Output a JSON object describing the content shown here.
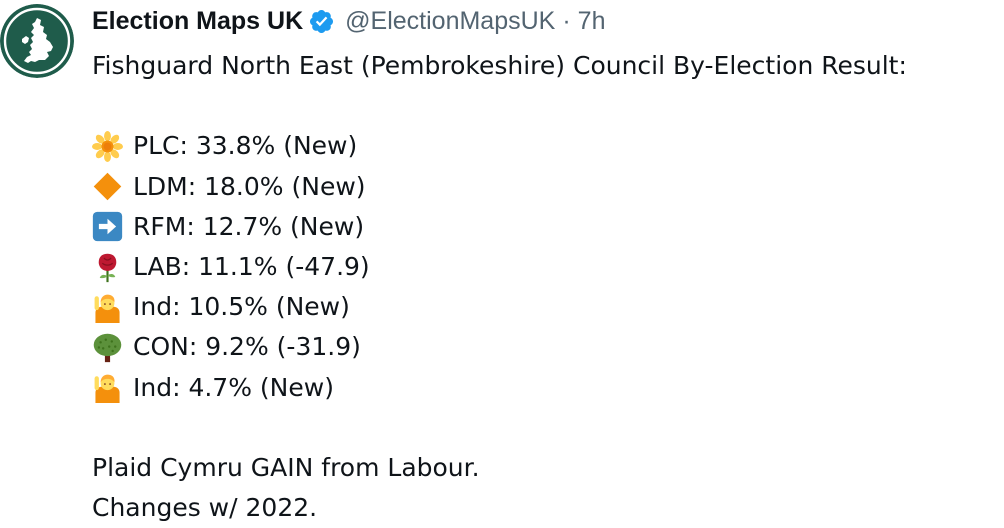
{
  "tweet": {
    "author": {
      "display_name": "Election Maps UK",
      "handle": "@ElectionMapsUK",
      "verified_icon": "verified-badge-icon",
      "avatar_icon": "uk-map-logo-icon"
    },
    "separator": "·",
    "time_ago": "7h",
    "headline": "Fishguard North East (Pembrokeshire) Council By-Election Result:",
    "results": [
      {
        "icon": "daisy-flower-icon",
        "text": "PLC: 33.8% (New)",
        "party": "PLC",
        "share": 33.8,
        "change": "New"
      },
      {
        "icon": "orange-diamond-icon",
        "text": "LDM: 18.0% (New)",
        "party": "LDM",
        "share": 18.0,
        "change": "New"
      },
      {
        "icon": "right-arrow-icon",
        "text": "RFM: 12.7% (New)",
        "party": "RFM",
        "share": 12.7,
        "change": "New"
      },
      {
        "icon": "rose-icon",
        "text": "LAB: 11.1% (-47.9)",
        "party": "LAB",
        "share": 11.1,
        "change": "-47.9"
      },
      {
        "icon": "person-raising-hand-icon",
        "text": "Ind: 10.5% (New)",
        "party": "Ind",
        "share": 10.5,
        "change": "New"
      },
      {
        "icon": "tree-icon",
        "text": "CON: 9.2% (-31.9)",
        "party": "CON",
        "share": 9.2,
        "change": "-31.9"
      },
      {
        "icon": "person-raising-hand-icon",
        "text": "Ind: 4.7% (New)",
        "party": "Ind",
        "share": 4.7,
        "change": "New"
      }
    ],
    "footer_lines": [
      "Plaid Cymru GAIN from Labour.",
      "Changes w/ 2022."
    ]
  },
  "colors": {
    "text_primary": "#0f1419",
    "text_secondary": "#536471",
    "verified_blue": "#1d9bf0",
    "avatar_green": "#1f5c4b"
  }
}
